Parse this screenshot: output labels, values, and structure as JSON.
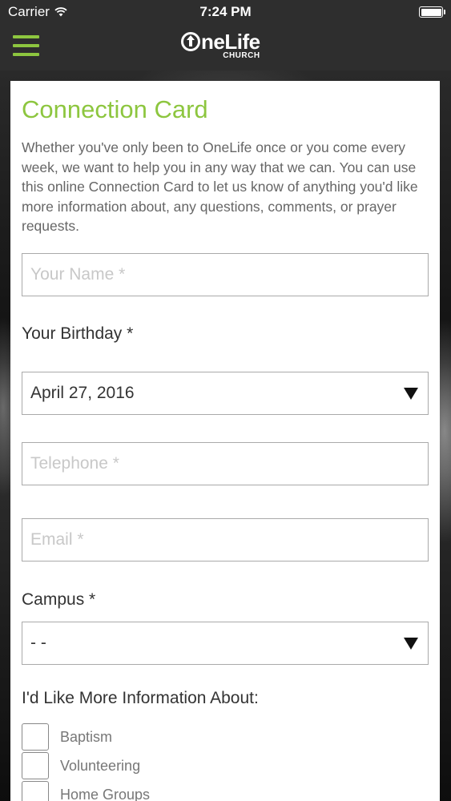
{
  "status_bar": {
    "carrier": "Carrier",
    "time": "7:24 PM"
  },
  "nav": {
    "logo_main": "neLife",
    "logo_sub": "CHURCH"
  },
  "form": {
    "title": "Connection Card",
    "intro": "Whether you've only been to OneLife once or you come every week, we want to help you in any way that we can. You can use this online Connection Card to let us know of anything you'd like more information about, any questions, comments, or prayer requests.",
    "name_placeholder": "Your Name *",
    "birthday_label": "Your Birthday *",
    "birthday_value": "April 27, 2016",
    "telephone_placeholder": "Telephone *",
    "email_placeholder": "Email *",
    "campus_label": "Campus *",
    "campus_value": "- -",
    "info_label": "I'd Like More Information About:",
    "options": [
      {
        "label": "Baptism",
        "checked": false
      },
      {
        "label": "Volunteering",
        "checked": false
      },
      {
        "label": "Home Groups",
        "checked": false
      }
    ]
  },
  "colors": {
    "accent": "#8dc63f",
    "bar": "#2e2e2e"
  }
}
